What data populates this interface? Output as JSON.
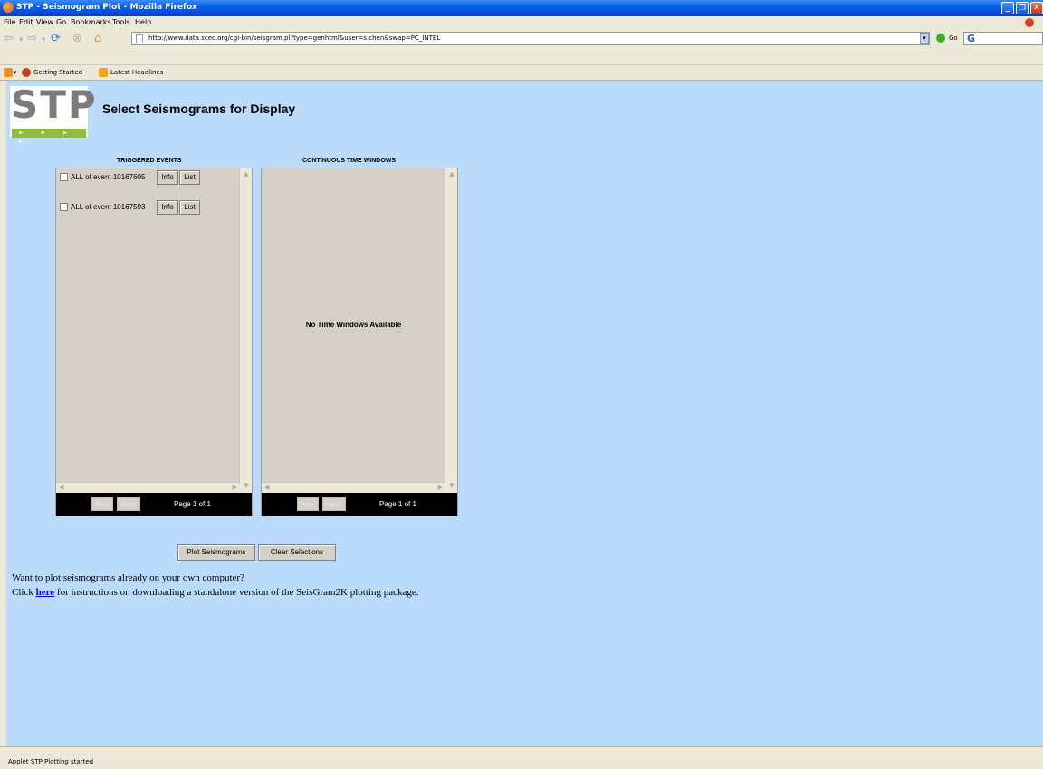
{
  "window": {
    "title": "STP - Seismogram Plot - Mozilla Firefox"
  },
  "menu": [
    "File",
    "Edit",
    "View",
    "Go",
    "Bookmarks",
    "Tools",
    "Help"
  ],
  "nav": {
    "url": "http://www.data.scec.org/cgi-bin/seisgram.pl?type=genhtml&user=s.chen&swap=PC_INTEL",
    "go_label": "Go",
    "google_glyph": "G"
  },
  "bookmarks": {
    "getting_started": "Getting Started",
    "latest_headlines": "Latest Headlines"
  },
  "page": {
    "logo_text": "STP",
    "logo_arrows": "► ► ► ►",
    "title": "Select Seismograms for Display",
    "triggered": {
      "label": "TRIGGERED EVENTS",
      "events": [
        {
          "label": "ALL of event 10167605",
          "info": "Info",
          "list": "List"
        },
        {
          "label": "ALL of event 10167593",
          "info": "Info",
          "list": "List"
        }
      ],
      "prev": "Prev",
      "next": "Next",
      "page_info": "Page 1 of 1"
    },
    "continuous": {
      "label": "CONTINUOUS TIME WINDOWS",
      "empty_message": "No Time Windows Available",
      "prev": "Prev",
      "next": "Next",
      "page_info": "Page 1 of 1"
    },
    "plot_button": "Plot Seismograms",
    "clear_button": "Clear Selections",
    "info_line1": "Want to plot seismograms already on your own computer?",
    "info_line2_prefix": "Click",
    "info_link": "here",
    "info_line2_suffix": "for instructions on downloading a standalone version of the SeisGram2K plotting package."
  },
  "status": {
    "text": "Applet STP Plotting started"
  }
}
